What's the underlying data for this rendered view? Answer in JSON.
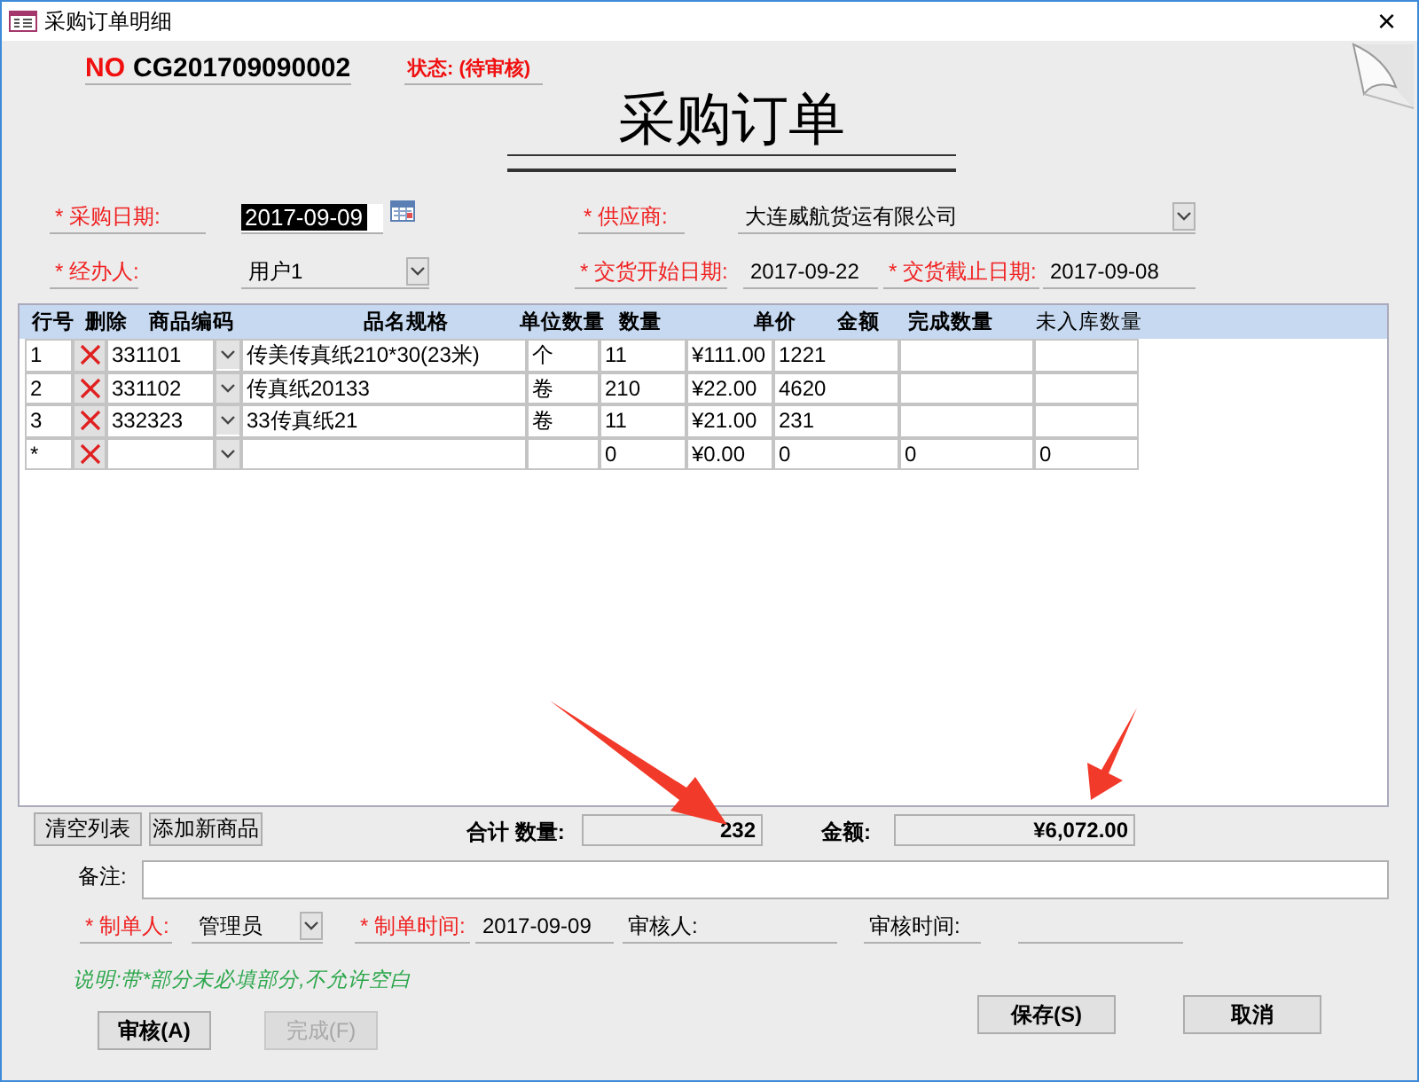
{
  "window": {
    "title": "采购订单明细",
    "close": "×"
  },
  "header": {
    "no_label": "NO",
    "order_no": "CG201709090002",
    "status": "状态: (待审核)",
    "heading": "采购订单"
  },
  "purchase_date": {
    "label": "* 采购日期:",
    "required": true,
    "value": "2017-09-09",
    "selected": true
  },
  "supplier": {
    "label": "* 供应商:",
    "required": true,
    "value": "大连威航货运有限公司"
  },
  "handler": {
    "label": "* 经办人:",
    "required": true,
    "value": "用户1"
  },
  "delivery_start": {
    "label": "* 交货开始日期:",
    "required": true,
    "value": "2017-09-22"
  },
  "delivery_end": {
    "label": "* 交货截止日期:",
    "required": true,
    "value": "2017-09-08"
  },
  "table": {
    "columns": [
      "行号",
      "删除",
      "商品编码",
      "品名规格",
      "单位数量",
      "数量",
      "单价",
      "金额",
      "完成数量",
      "未入库数量"
    ],
    "rows": [
      {
        "no": "1",
        "code": "331101",
        "name": "传美传真纸210*30(23米)",
        "unit": "个",
        "qty": "11",
        "price": "¥111.00",
        "amount": "1221"
      },
      {
        "no": "2",
        "code": "331102",
        "name": "传真纸20133",
        "unit": "卷",
        "qty": "210",
        "price": "¥22.00",
        "amount": "4620"
      },
      {
        "no": "3",
        "code": "332323",
        "name": "33传真纸21",
        "unit": "卷",
        "qty": "11",
        "price": "¥21.00",
        "amount": "231"
      },
      {
        "no": "*",
        "qty": "0",
        "price": "¥0.00",
        "amount": "0",
        "done": "0",
        "pending": "0"
      }
    ]
  },
  "totals": {
    "buttons": [
      "清空列表",
      "添加新商品"
    ],
    "qty_label": "合计 数量:",
    "qty": "232",
    "amount_label": "金额:",
    "amount": "¥6,072.00"
  },
  "remarks": {
    "label": "备注:"
  },
  "maker": {
    "label": "* 制单人:",
    "required": true,
    "value": "管理员"
  },
  "made_time": {
    "label": "* 制单时间:",
    "required": true,
    "value": "2017-09-09"
  },
  "reviewer": {
    "label": "审核人:",
    "required": false
  },
  "review_time": {
    "label": "审核时间:",
    "required": false
  },
  "note": "说明:带*部分未必填部分,不允许空白",
  "buttons": [
    {
      "label": "审核(A)",
      "disabled": false
    },
    {
      "label": "完成(F)",
      "disabled": true
    },
    {
      "label": "保存(S)",
      "disabled": false
    },
    {
      "label": "取消",
      "disabled": false
    }
  ]
}
